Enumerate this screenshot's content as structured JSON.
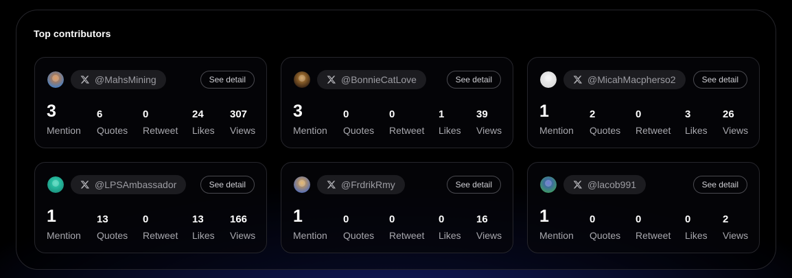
{
  "title": "Top contributors",
  "see_detail_label": "See detail",
  "stat_labels": {
    "mention": "Mention",
    "quotes": "Quotes",
    "retweet": "Retweet",
    "likes": "Likes",
    "views": "Views"
  },
  "contributors": [
    {
      "handle": "@MahsMining",
      "mention": "3",
      "quotes": "6",
      "retweet": "0",
      "likes": "24",
      "views": "307",
      "avatar_colors": [
        "#d97a2a",
        "#3a7fd0"
      ]
    },
    {
      "handle": "@BonnieCatLove",
      "mention": "3",
      "quotes": "0",
      "retweet": "0",
      "likes": "1",
      "views": "39",
      "avatar_colors": [
        "#c78b3a",
        "#2b1a10"
      ]
    },
    {
      "handle": "@MicahMacpherso2",
      "mention": "1",
      "quotes": "2",
      "retweet": "0",
      "likes": "3",
      "views": "26",
      "avatar_colors": [
        "#f2f2f2",
        "#d8d8d8"
      ]
    },
    {
      "handle": "@LPSAmbassador",
      "mention": "1",
      "quotes": "13",
      "retweet": "0",
      "likes": "13",
      "views": "166",
      "avatar_colors": [
        "#2fd6b4",
        "#1a8f7c"
      ]
    },
    {
      "handle": "@FrdrikRmy",
      "mention": "1",
      "quotes": "0",
      "retweet": "0",
      "likes": "0",
      "views": "16",
      "avatar_colors": [
        "#e0a240",
        "#4a6ac0"
      ]
    },
    {
      "handle": "@lacob991",
      "mention": "1",
      "quotes": "0",
      "retweet": "0",
      "likes": "0",
      "views": "2",
      "avatar_colors": [
        "#3f4fc8",
        "#3fa05a"
      ]
    }
  ]
}
